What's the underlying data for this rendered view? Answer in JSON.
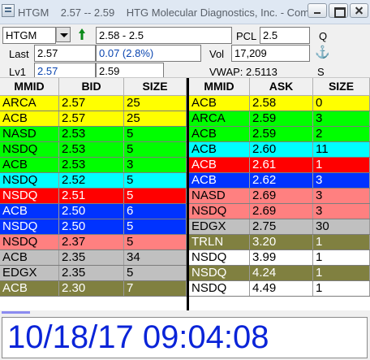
{
  "window": {
    "symbol": "HTGM",
    "range": "2.57 -- 2.59",
    "company": "HTG Molecular Diagnostics, Inc. - Comm..."
  },
  "header": {
    "symbol_value": "HTGM",
    "bidask_value": "2.58 - 2.5",
    "pcl_label": "PCL",
    "pcl_value": "2.5",
    "q_label": "Q",
    "last_label": "Last",
    "last_value": "2.57",
    "change_value": "0.07  (2.8%)",
    "vol_label": "Vol",
    "vol_value": "17,209",
    "lv1_label": "Lv1",
    "lv1_bid": "2.57",
    "lv1_ask": "2.59",
    "vwap_label": "VWAP:",
    "vwap_value": "2.5113",
    "s_label": "S"
  },
  "colors": {
    "yellow": "#ffff00",
    "green": "#00ff00",
    "cyan": "#00ffff",
    "red": "#ff0000",
    "blue": "#0033ff",
    "salmon": "#ff8080",
    "gray": "#c0c0c0",
    "olive": "#808040",
    "clock_text": "#0a24d8"
  },
  "bid_book": {
    "headers": [
      "MMID",
      "BID",
      "SIZE"
    ],
    "rows": [
      {
        "mmid": "ARCA",
        "price": "2.57",
        "size": "25",
        "color": "yellow"
      },
      {
        "mmid": "ACB",
        "price": "2.57",
        "size": "25",
        "color": "yellow"
      },
      {
        "mmid": "NASD",
        "price": "2.53",
        "size": "5",
        "color": "green"
      },
      {
        "mmid": "NSDQ",
        "price": "2.53",
        "size": "5",
        "color": "green"
      },
      {
        "mmid": "ACB",
        "price": "2.53",
        "size": "3",
        "color": "green"
      },
      {
        "mmid": "NSDQ",
        "price": "2.52",
        "size": "5",
        "color": "cyan"
      },
      {
        "mmid": "NSDQ",
        "price": "2.51",
        "size": "5",
        "color": "red"
      },
      {
        "mmid": "ACB",
        "price": "2.50",
        "size": "6",
        "color": "blue"
      },
      {
        "mmid": "NSDQ",
        "price": "2.50",
        "size": "5",
        "color": "blue"
      },
      {
        "mmid": "NSDQ",
        "price": "2.37",
        "size": "5",
        "color": "salmon"
      },
      {
        "mmid": "ACB",
        "price": "2.35",
        "size": "34",
        "color": "gray"
      },
      {
        "mmid": "EDGX",
        "price": "2.35",
        "size": "5",
        "color": "gray"
      },
      {
        "mmid": "ACB",
        "price": "2.30",
        "size": "7",
        "color": "olive"
      }
    ]
  },
  "ask_book": {
    "headers": [
      "MMID",
      "ASK",
      "SIZE"
    ],
    "rows": [
      {
        "mmid": "ACB",
        "price": "2.58",
        "size": "0",
        "color": "yellow"
      },
      {
        "mmid": "ARCA",
        "price": "2.59",
        "size": "3",
        "color": "green"
      },
      {
        "mmid": "ACB",
        "price": "2.59",
        "size": "2",
        "color": "green"
      },
      {
        "mmid": "ACB",
        "price": "2.60",
        "size": "11",
        "color": "cyan"
      },
      {
        "mmid": "ACB",
        "price": "2.61",
        "size": "1",
        "color": "red"
      },
      {
        "mmid": "ACB",
        "price": "2.62",
        "size": "3",
        "color": "blue"
      },
      {
        "mmid": "NASD",
        "price": "2.69",
        "size": "3",
        "color": "salmon"
      },
      {
        "mmid": "NSDQ",
        "price": "2.69",
        "size": "3",
        "color": "salmon"
      },
      {
        "mmid": "EDGX",
        "price": "2.75",
        "size": "30",
        "color": "gray"
      },
      {
        "mmid": "TRLN",
        "price": "3.20",
        "size": "1",
        "color": "olive"
      },
      {
        "mmid": "NSDQ",
        "price": "3.99",
        "size": "1",
        "color": "white"
      },
      {
        "mmid": "NSDQ",
        "price": "4.24",
        "size": "1",
        "color": "olive"
      },
      {
        "mmid": "NSDQ",
        "price": "4.49",
        "size": "1",
        "color": "white"
      }
    ]
  },
  "clock": "10/18/17  09:04:08"
}
